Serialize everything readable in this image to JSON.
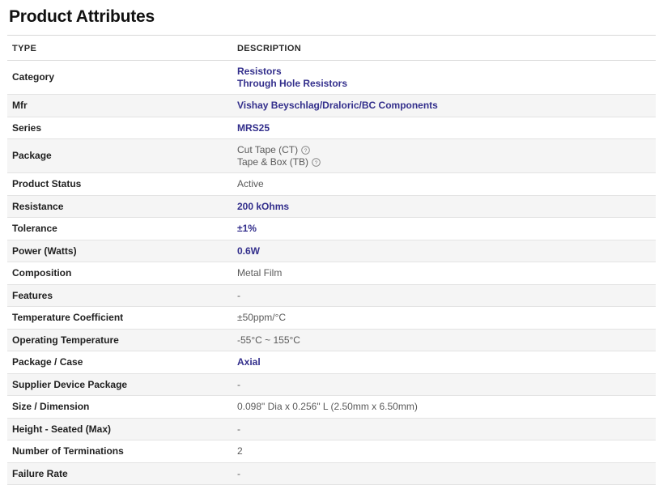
{
  "page": {
    "title": "Product Attributes"
  },
  "colors": {
    "link": "#332f8c",
    "value_text": "#5a5a5a",
    "row_shade": "#f5f5f5",
    "row_plain": "#ffffff",
    "border": "#e3e3e3",
    "header_border": "#d8d8d8"
  },
  "table": {
    "columns": [
      {
        "key": "type",
        "label": "TYPE"
      },
      {
        "key": "description",
        "label": "DESCRIPTION"
      }
    ],
    "rows": [
      {
        "type": "Category",
        "shaded": false,
        "values": [
          {
            "text": "Resistors",
            "link": true,
            "help": false
          },
          {
            "text": "Through Hole Resistors",
            "link": true,
            "help": false
          }
        ]
      },
      {
        "type": "Mfr",
        "shaded": true,
        "values": [
          {
            "text": "Vishay Beyschlag/Draloric/BC Components",
            "link": true,
            "help": false
          }
        ]
      },
      {
        "type": "Series",
        "shaded": false,
        "values": [
          {
            "text": "MRS25",
            "link": true,
            "help": false
          }
        ]
      },
      {
        "type": "Package",
        "shaded": true,
        "values": [
          {
            "text": "Cut Tape (CT)",
            "link": false,
            "help": true
          },
          {
            "text": "Tape & Box (TB)",
            "link": false,
            "help": true
          }
        ]
      },
      {
        "type": "Product Status",
        "shaded": false,
        "values": [
          {
            "text": "Active",
            "link": false,
            "help": false
          }
        ]
      },
      {
        "type": "Resistance",
        "shaded": true,
        "values": [
          {
            "text": "200 kOhms",
            "link": true,
            "help": false
          }
        ]
      },
      {
        "type": "Tolerance",
        "shaded": false,
        "values": [
          {
            "text": "±1%",
            "link": true,
            "help": false
          }
        ]
      },
      {
        "type": "Power (Watts)",
        "shaded": true,
        "values": [
          {
            "text": "0.6W",
            "link": true,
            "help": false
          }
        ]
      },
      {
        "type": "Composition",
        "shaded": false,
        "values": [
          {
            "text": "Metal Film",
            "link": false,
            "help": false
          }
        ]
      },
      {
        "type": "Features",
        "shaded": true,
        "values": [
          {
            "text": "-",
            "link": false,
            "help": false
          }
        ]
      },
      {
        "type": "Temperature Coefficient",
        "shaded": false,
        "values": [
          {
            "text": "±50ppm/°C",
            "link": false,
            "help": false
          }
        ]
      },
      {
        "type": "Operating Temperature",
        "shaded": true,
        "values": [
          {
            "text": "-55°C ~ 155°C",
            "link": false,
            "help": false
          }
        ]
      },
      {
        "type": "Package / Case",
        "shaded": false,
        "values": [
          {
            "text": "Axial",
            "link": true,
            "help": false
          }
        ]
      },
      {
        "type": "Supplier Device Package",
        "shaded": true,
        "values": [
          {
            "text": "-",
            "link": false,
            "help": false
          }
        ]
      },
      {
        "type": "Size / Dimension",
        "shaded": false,
        "values": [
          {
            "text": "0.098\" Dia x 0.256\" L (2.50mm x 6.50mm)",
            "link": false,
            "help": false
          }
        ]
      },
      {
        "type": "Height - Seated (Max)",
        "shaded": true,
        "values": [
          {
            "text": "-",
            "link": false,
            "help": false
          }
        ]
      },
      {
        "type": "Number of Terminations",
        "shaded": false,
        "values": [
          {
            "text": "2",
            "link": false,
            "help": false
          }
        ]
      },
      {
        "type": "Failure Rate",
        "shaded": true,
        "values": [
          {
            "text": "-",
            "link": false,
            "help": false
          }
        ]
      }
    ]
  },
  "icons": {
    "help": "help-circle-icon"
  }
}
